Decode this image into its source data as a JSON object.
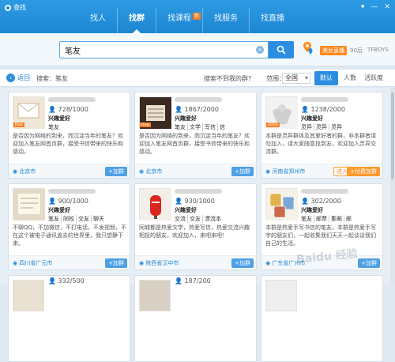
{
  "window": {
    "title": "查找",
    "controls": [
      "▾",
      "—",
      "✕"
    ]
  },
  "nav": {
    "tabs": [
      {
        "label": "找人",
        "active": false
      },
      {
        "label": "找群",
        "active": true
      },
      {
        "label": "找课程",
        "active": false,
        "badge": "新"
      },
      {
        "label": "找服务",
        "active": false
      },
      {
        "label": "找直播",
        "active": false
      }
    ]
  },
  "search": {
    "value": "笔友",
    "clear": "×"
  },
  "profile": {
    "tag": "美女直播",
    "age": "90后",
    "name": "TFBOYS"
  },
  "filter": {
    "back_label": "返回",
    "back_icon": "‹",
    "crumb": "搜索：笔友",
    "not_found": "搜索不到我的群?",
    "range_label": "范围：",
    "range_value": "全国",
    "sort_tabs": [
      {
        "label": "默认",
        "active": true
      },
      {
        "label": "人数",
        "active": false
      },
      {
        "label": "活跃度",
        "active": false
      }
    ]
  },
  "cards": [
    {
      "count": "728/1000",
      "category": "兴趣爱好",
      "tags": [
        "笔友"
      ],
      "desc": "是否因为网络的到来，而沉淀当年的笔友？欢迎加入笔友网首页群，接受书信带来的快乐和感动。",
      "city": "北京市",
      "join": "+加群",
      "join_style": "blue",
      "free": "free"
    },
    {
      "count": "1867/2000",
      "category": "兴趣爱好",
      "tags": [
        "笔友",
        "文学",
        "写信",
        "信"
      ],
      "desc": "是否因为网络的到来，而沉淀当年的笔友？欢迎加入笔友网首页群，接受书信带来的快乐和感动。",
      "city": "北京市",
      "join": "+加群",
      "join_style": "blue",
      "free": "free"
    },
    {
      "count": "1238/2000",
      "category": "兴趣爱好",
      "tags": [
        "灵异",
        "灵异",
        "灵异"
      ],
      "desc": "本群是灵异群体及其爱好者的群，非本群者请勿加入，请大家随意找到友，欢迎加入灵异交流群。",
      "city": "河南省郑州市",
      "join": "+付费加群",
      "join_style": "orange",
      "enter": "进入",
      "free": "2000"
    },
    {
      "count": "900/1000",
      "category": "兴趣爱好",
      "tags": [
        "笔友",
        "同校",
        "交友",
        "聊天"
      ],
      "desc": "不聊QQ，不加微信，不打电话，不发视频，不在这个被电子通讯盖去的世界里，我只想静下来。",
      "city": "四川省广元市",
      "join": "+加群",
      "join_style": "blue",
      "free": ""
    },
    {
      "count": "930/1000",
      "category": "兴趣爱好",
      "tags": [
        "交流",
        "交友",
        "漂流本"
      ],
      "desc": "同城都是热爱文学，热爱写信，热爱交流兴趣相投的朋友，欢迎加入，来吧来吧！",
      "city": "陕西省汉中市",
      "join": "+加群",
      "join_style": "blue",
      "free": ""
    },
    {
      "count": "302/2000",
      "category": "兴趣爱好",
      "tags": [
        "笔友",
        "邮票",
        "集邮",
        "邮"
      ],
      "desc": "本群是热爱手写书信的笔友，本群是热爱手写字的朋友们，一起收集我们天天一起谈谈我们自己的生活。",
      "city": "广东省广州市",
      "join": "+加群",
      "join_style": "blue",
      "free": ""
    },
    {
      "count": "332/500",
      "category": "",
      "tags": [],
      "desc": "",
      "city": "",
      "join": "",
      "join_style": "blue",
      "free": ""
    },
    {
      "count": "187/200",
      "category": "",
      "tags": [],
      "desc": "",
      "city": "",
      "join": "",
      "join_style": "blue",
      "free": ""
    },
    {
      "count": "",
      "category": "",
      "tags": [],
      "desc": "",
      "city": "",
      "join": "",
      "join_style": "blue",
      "free": ""
    }
  ],
  "watermark": "Baidu 经验"
}
